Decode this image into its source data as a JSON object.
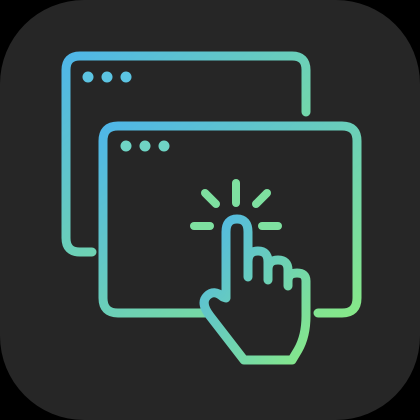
{
  "icon": {
    "name": "multi-window-click-app-icon",
    "background_color": "#262626",
    "gradient_start": "#4fb6e8",
    "gradient_end": "#86e889",
    "glyphs": [
      "browser-window-icon",
      "browser-window-icon",
      "pointing-hand-icon",
      "click-burst-icon"
    ]
  }
}
